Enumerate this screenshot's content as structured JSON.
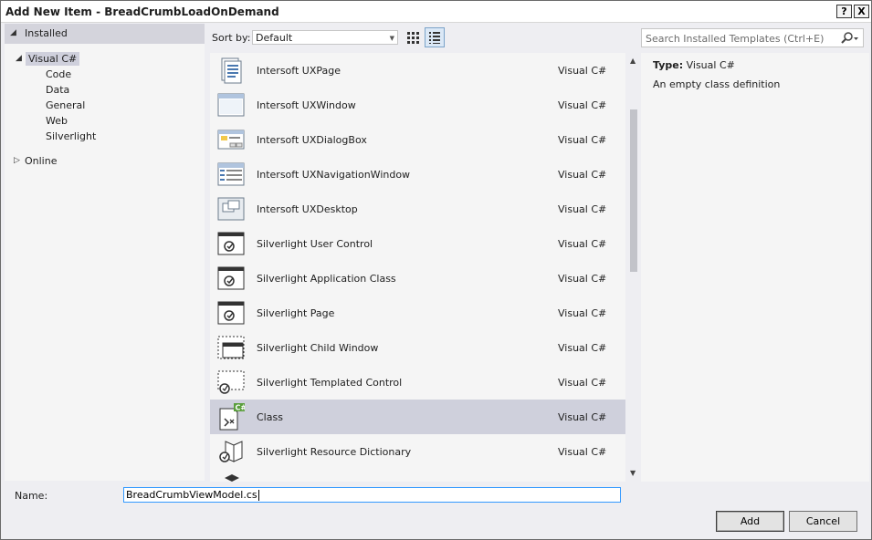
{
  "window": {
    "title": "Add New Item - BreadCrumbLoadOnDemand",
    "help_glyph": "?",
    "close_glyph": "X"
  },
  "tree": {
    "installed": "Installed",
    "visual_csharp": "Visual C#",
    "children": [
      "Code",
      "Data",
      "General",
      "Web",
      "Silverlight"
    ],
    "online": "Online"
  },
  "toolbar": {
    "sort_label": "Sort by:",
    "sort_value": "Default",
    "icons": [
      "small-icons-view-icon",
      "details-list-view-icon"
    ]
  },
  "templates": [
    {
      "name": "Intersoft UXPage",
      "lang": "Visual C#",
      "icon": "uxpage-icon"
    },
    {
      "name": "Intersoft UXWindow",
      "lang": "Visual C#",
      "icon": "uxwindow-icon"
    },
    {
      "name": "Intersoft UXDialogBox",
      "lang": "Visual C#",
      "icon": "uxdialogbox-icon"
    },
    {
      "name": "Intersoft UXNavigationWindow",
      "lang": "Visual C#",
      "icon": "uxnavigationwindow-icon"
    },
    {
      "name": "Intersoft UXDesktop",
      "lang": "Visual C#",
      "icon": "uxdesktop-icon"
    },
    {
      "name": "Silverlight User Control",
      "lang": "Visual C#",
      "icon": "silverlight-user-control-icon"
    },
    {
      "name": "Silverlight Application Class",
      "lang": "Visual C#",
      "icon": "silverlight-application-class-icon"
    },
    {
      "name": "Silverlight Page",
      "lang": "Visual C#",
      "icon": "silverlight-page-icon"
    },
    {
      "name": "Silverlight Child Window",
      "lang": "Visual C#",
      "icon": "silverlight-child-window-icon"
    },
    {
      "name": "Silverlight Templated Control",
      "lang": "Visual C#",
      "icon": "silverlight-templated-control-icon"
    },
    {
      "name": "Class",
      "lang": "Visual C#",
      "icon": "csharp-class-icon",
      "selected": true
    },
    {
      "name": "Silverlight Resource Dictionary",
      "lang": "Visual C#",
      "icon": "silverlight-resource-dictionary-icon"
    }
  ],
  "search": {
    "placeholder": "Search Installed Templates (Ctrl+E)"
  },
  "details": {
    "type_label": "Type:",
    "type_value": "Visual C#",
    "description": "An empty class definition"
  },
  "bottom": {
    "name_label": "Name:",
    "name_value": "BreadCrumbViewModel.cs",
    "add_label": "Add",
    "cancel_label": "Cancel"
  },
  "colors": {
    "selection": "#cfd0dc",
    "panel": "#f5f5f5",
    "chrome": "#eeeef2",
    "focus_border": "#3399ff"
  }
}
